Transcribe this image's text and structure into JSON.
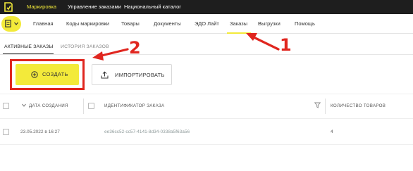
{
  "top_tabs": [
    {
      "label": "Маркировка",
      "active": true
    },
    {
      "label": "Управление заказами",
      "active": false
    },
    {
      "label": "Национальный каталог",
      "active": false
    }
  ],
  "nav": {
    "items": [
      "Главная",
      "Коды маркировки",
      "Товары",
      "Документы",
      "ЭДО Лайт",
      "Заказы",
      "Выгрузки",
      "Помощь"
    ],
    "active": "Заказы"
  },
  "subtabs": [
    "АКТИВНЫЕ ЗАКАЗЫ",
    "ИСТОРИЯ ЗАКАЗОВ"
  ],
  "buttons": {
    "create": "СОЗДАТЬ",
    "import": "ИМПОРТИРОВАТЬ"
  },
  "table": {
    "columns": [
      "ДАТА СОЗДАНИЯ",
      "ИДЕНТИФИКАТОР ЗАКАЗА",
      "КОЛИЧЕСТВО ТОВАРОВ"
    ],
    "rows": [
      {
        "date": "23.05.2022 в 16:27",
        "id": "ee36cc52-cc57-4141-8d34-0338a5f63a56",
        "qty": "4"
      }
    ]
  },
  "annotations": {
    "marker_1": "1",
    "marker_2": "2"
  },
  "colors": {
    "accent": "#f3ea3a",
    "topbar": "#1e1e1e",
    "annotation": "#e0261f"
  },
  "icons": [
    "logo-icon",
    "document-icon",
    "chevron-down-icon",
    "plus-circle-icon",
    "upload-icon",
    "sort-down-icon",
    "filter-icon"
  ]
}
